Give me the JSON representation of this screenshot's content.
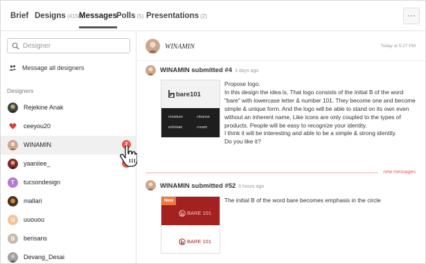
{
  "tabs": [
    {
      "label": "Brief",
      "count": ""
    },
    {
      "label": "Designs",
      "count": "(4156)"
    },
    {
      "label": "Messages",
      "count": ""
    },
    {
      "label": "Polls",
      "count": "(5)"
    },
    {
      "label": "Presentations",
      "count": "(2)"
    }
  ],
  "active_tab": "Messages",
  "more_label": "···",
  "sidebar": {
    "search_placeholder": "Designer",
    "message_all": "Message all designers",
    "section_label": "Designers",
    "designers": [
      {
        "name": "Rejekine Anak",
        "avatar_letter": "",
        "avatar_color": "#3c4a3a",
        "badge": ""
      },
      {
        "name": "ceeyou20",
        "avatar_letter": "",
        "avatar_color": "#e03a3a",
        "badge": ""
      },
      {
        "name": "WINAMIN",
        "avatar_letter": "",
        "avatar_color": "#caa88e",
        "badge": "2"
      },
      {
        "name": "yaaniiee_",
        "avatar_letter": "",
        "avatar_color": "#7b2b2b",
        "badge": "1"
      },
      {
        "name": "tucsondesign",
        "avatar_letter": "T",
        "avatar_color": "#b57bd0",
        "badge": ""
      },
      {
        "name": "mallari",
        "avatar_letter": "",
        "avatar_color": "#8a6a3c",
        "badge": ""
      },
      {
        "name": "uuouou",
        "avatar_letter": "U",
        "avatar_color": "#f2c49c",
        "badge": ""
      },
      {
        "name": "berisans",
        "avatar_letter": "B",
        "avatar_color": "#c8b9a8",
        "badge": ""
      },
      {
        "name": "Devang_Desai",
        "avatar_letter": "",
        "avatar_color": "#9aa0a6",
        "badge": ""
      }
    ]
  },
  "conversation": {
    "name": "WINAMIN",
    "time": "Today at 5:27 PM",
    "new_messages_label": "new messages",
    "submissions": [
      {
        "title": "WINAMIN submitted #4",
        "ago": "3 days ago",
        "text_lines": [
          "Propose logo.",
          "In this design the idea is, That logo consists of the initial B of the word \"bare\" with lowercase letter & number 101. They become one and become simple & unique form. And the logo will be able to stand on its own even without an inherent name, Like icons are only coupled to the types of products. People will be easy to recognize your identity.",
          "I think it will be interesting and able to be a simple & strong identity.",
          "Do you like it?"
        ],
        "thumb": {
          "brand": "bare101",
          "labels": [
            "moisture",
            "cleanse",
            "exfoliate",
            "cream"
          ]
        }
      },
      {
        "title": "WINAMIN submitted #52",
        "ago": "6 hours ago",
        "text": "The initial B of the word bare becomes emphasis in the circle",
        "thumb": {
          "new_tag": "New",
          "brand_top": "BARE 101",
          "brand_bottom": "BARE 101"
        }
      }
    ]
  }
}
